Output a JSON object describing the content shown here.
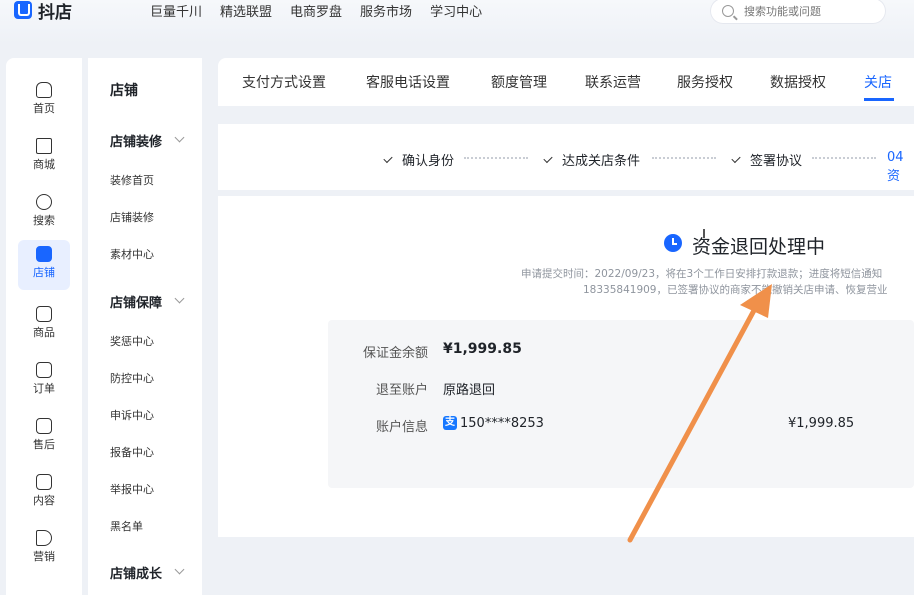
{
  "app": {
    "logo_text": "抖店"
  },
  "topnav": [
    "巨量千川",
    "精选联盟",
    "电商罗盘",
    "服务市场",
    "学习中心"
  ],
  "search": {
    "placeholder": "搜索功能或问题"
  },
  "iconnav": [
    {
      "label": "首页",
      "icon": "home-icon"
    },
    {
      "label": "商城",
      "icon": "mall-icon"
    },
    {
      "label": "搜索",
      "icon": "search-icon"
    },
    {
      "label": "店铺",
      "icon": "shop-icon",
      "active": true
    },
    {
      "label": "商品",
      "icon": "product-icon"
    },
    {
      "label": "订单",
      "icon": "order-icon"
    },
    {
      "label": "售后",
      "icon": "aftersale-icon"
    },
    {
      "label": "内容",
      "icon": "content-icon"
    },
    {
      "label": "营销",
      "icon": "marketing-icon"
    }
  ],
  "subnav": {
    "title": "店铺",
    "group1": "店铺装修",
    "group1_items": [
      "装修首页",
      "店铺装修",
      "素材中心"
    ],
    "group2": "店铺保障",
    "group2_items": [
      "奖惩中心",
      "防控中心",
      "申诉中心",
      "报备中心",
      "举报中心",
      "黑名单"
    ],
    "group3": "店铺成长"
  },
  "tabs": [
    "支付方式设置",
    "客服电话设置",
    "额度管理",
    "联系运营",
    "服务授权",
    "数据授权",
    "关店"
  ],
  "active_tab": "关店",
  "steps": [
    "确认身份",
    "达成关店条件",
    "签署协议",
    "04 资"
  ],
  "status": {
    "title": "资金退回处理中",
    "notice_line1": "申请提交时间：2022/09/23，将在3个工作日安排打款退款；进度将短信通知",
    "notice_line2": "18335841909，已签署协议的商家不能撤销关店申请、恢复营业"
  },
  "refund": {
    "balance_label": "保证金余额",
    "balance_value": "¥1,999.85",
    "account_label": "退至账户",
    "account_value": "原路退回",
    "info_label": "账户信息",
    "alipay_glyph": "支",
    "account_number": "150****8253",
    "account_amount": "¥1,999.85"
  },
  "colors": {
    "accent": "#1966ff",
    "annotation_arrow": "#f0904a"
  }
}
